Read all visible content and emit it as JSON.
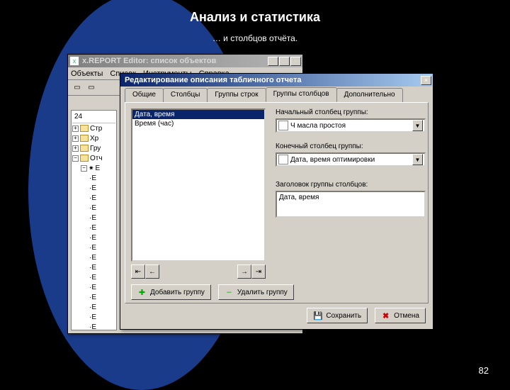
{
  "slide": {
    "title": "Анализ и статистика",
    "subtitle": "… и столбцов отчёта.",
    "page": "82"
  },
  "parent": {
    "title": "x.REPORT Editor: список объектов",
    "menu": {
      "m1": "Объекты",
      "m2": "Список",
      "m3": "Инструменты",
      "m4": "Справка"
    },
    "tree_header": "24",
    "tree": {
      "i0": "Стр",
      "i1": "Хр",
      "i2": "Гру",
      "i3": "Отч",
      "i4": "Е"
    }
  },
  "dialog": {
    "title": "Редактирование описания табличного отчета",
    "tabs": {
      "t1": "Общие",
      "t2": "Столбцы",
      "t3": "Группы строк",
      "t4": "Группы столбцов",
      "t5": "Дополнительно"
    },
    "list": {
      "i0": "Дата, время",
      "i1": "Время (час)"
    },
    "fields": {
      "start_label": "Начальный столбец группы:",
      "start_value": "Ч масла простоя",
      "end_label": "Конечный столбец группы:",
      "end_value": "Дата, время оптимировки",
      "header_label": "Заголовок группы столбцов:",
      "header_value": "Дата, время"
    },
    "btns": {
      "add": "Добавить группу",
      "del": "Удалить группу",
      "save": "Сохранить",
      "cancel": "Отмена"
    }
  }
}
